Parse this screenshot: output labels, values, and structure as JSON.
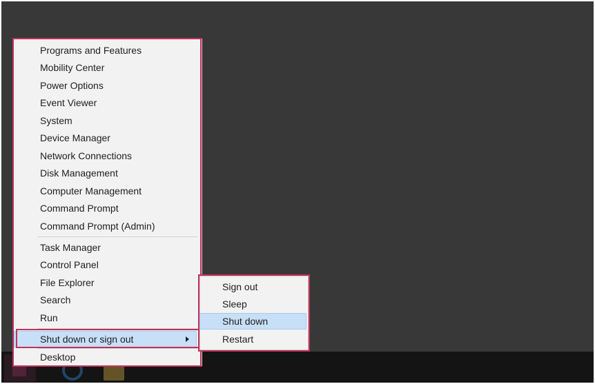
{
  "context_menu": {
    "group1": [
      "Programs and Features",
      "Mobility Center",
      "Power Options",
      "Event Viewer",
      "System",
      "Device Manager",
      "Network Connections",
      "Disk Management",
      "Computer Management",
      "Command Prompt",
      "Command Prompt (Admin)"
    ],
    "group2": [
      "Task Manager",
      "Control Panel",
      "File Explorer",
      "Search",
      "Run"
    ],
    "shutdown_label": "Shut down or sign out",
    "desktop_label": "Desktop"
  },
  "submenu": {
    "items": [
      "Sign out",
      "Sleep",
      "Shut down",
      "Restart"
    ],
    "highlighted": "Shut down"
  },
  "colors": {
    "desktop_bg": "#383838",
    "taskbar_bg": "#141414",
    "menu_bg": "#f2f2f2",
    "highlight_bg": "#c7dff7",
    "annotation_outline": "#c0325c"
  },
  "taskbar": {
    "icons": [
      "start-icon",
      "internet-explorer-icon",
      "file-explorer-icon"
    ]
  }
}
